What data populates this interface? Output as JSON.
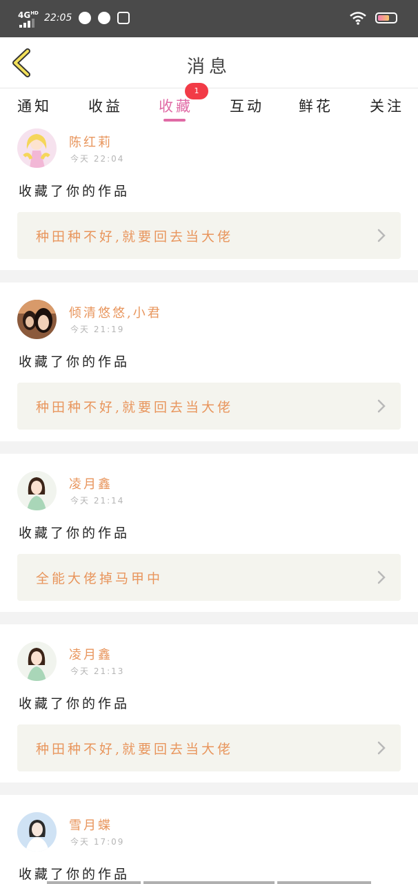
{
  "status_bar": {
    "network": "4G",
    "network_sup": "HD",
    "time": "22:05"
  },
  "header": {
    "title": "消息",
    "back_icon": "chevron-left-icon",
    "back_color": "#f2e05a"
  },
  "tabs": [
    {
      "label": "通知",
      "active": false
    },
    {
      "label": "收益",
      "active": false
    },
    {
      "label": "收藏",
      "active": true,
      "badge": "1"
    },
    {
      "label": "互动",
      "active": false
    },
    {
      "label": "鲜花",
      "active": false
    },
    {
      "label": "关注",
      "active": false
    }
  ],
  "colors": {
    "accent": "#e06aa5",
    "name": "#e8955c",
    "badge": "#f23b47",
    "work_bg": "#f4f4ee"
  },
  "items": [
    {
      "user": "陈红莉",
      "time": "今天 22:04",
      "action": "收藏了你的作品",
      "work": "种田种不好,就要回去当大佬",
      "avatar_icon": "anime-girl-avatar"
    },
    {
      "user": "倾清悠悠,小君",
      "time": "今天 21:19",
      "action": "收藏了你的作品",
      "work": "种田种不好,就要回去当大佬",
      "avatar_icon": "photo-avatar"
    },
    {
      "user": "凌月鑫",
      "time": "今天 21:14",
      "action": "收藏了你的作品",
      "work": "全能大佬掉马甲中",
      "avatar_icon": "cartoon-girl-avatar"
    },
    {
      "user": "凌月鑫",
      "time": "今天 21:13",
      "action": "收藏了你的作品",
      "work": "种田种不好,就要回去当大佬",
      "avatar_icon": "cartoon-girl-avatar"
    },
    {
      "user": "雪月蝶",
      "time": "今天 17:09",
      "action": "收藏了你的作品",
      "work": "",
      "avatar_icon": "photo-avatar"
    }
  ]
}
